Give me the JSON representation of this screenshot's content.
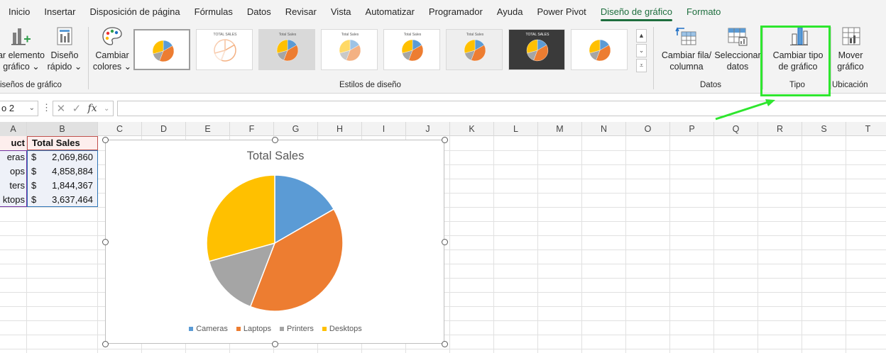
{
  "ribbon_tabs": [
    {
      "label": "Inicio"
    },
    {
      "label": "Insertar"
    },
    {
      "label": "Disposición de página"
    },
    {
      "label": "Fórmulas"
    },
    {
      "label": "Datos"
    },
    {
      "label": "Revisar"
    },
    {
      "label": "Vista"
    },
    {
      "label": "Automatizar"
    },
    {
      "label": "Programador"
    },
    {
      "label": "Ayuda"
    },
    {
      "label": "Power Pivot"
    },
    {
      "label": "Diseño de gráfico"
    },
    {
      "label": "Formato"
    }
  ],
  "active_tab": "Diseño de gráfico",
  "ribbon": {
    "add_element": {
      "line1": "ar elemento",
      "line2": "gráfico ⌄"
    },
    "quick_layout": {
      "line1": "Diseño",
      "line2": "rápido ⌄"
    },
    "group_layouts": "iseños de gráfico",
    "change_colors": {
      "line1": "Cambiar",
      "line2": "colores ⌄"
    },
    "group_styles": "Estilos de diseño",
    "switch_row_col": {
      "line1": "Cambiar fila/",
      "line2": "columna"
    },
    "select_data": {
      "line1": "Seleccionar",
      "line2": "datos"
    },
    "group_data": "Datos",
    "change_type": {
      "line1": "Cambiar tipo",
      "line2": "de gráfico"
    },
    "group_type": "Tipo",
    "move_chart": {
      "line1": "Mover",
      "line2": "gráfico"
    },
    "group_location": "Ubicación",
    "gallery_thumb_titles": [
      "TOTAL SALES",
      "Total Sales",
      "Total Sales",
      "Total Sales",
      "Total Sales",
      "TOTAL SALES"
    ]
  },
  "formula_bar": {
    "name_box": "o 2",
    "fx": "fx",
    "formula": ""
  },
  "columns": [
    "A",
    "B",
    "C",
    "D",
    "E",
    "F",
    "G",
    "H",
    "I",
    "J",
    "K",
    "L",
    "M",
    "N",
    "O",
    "P",
    "Q",
    "R",
    "S",
    "T"
  ],
  "table": {
    "header": [
      "uct",
      "Total Sales"
    ],
    "rows": [
      {
        "product": "eras",
        "currency": "$",
        "value": "2,069,860"
      },
      {
        "product": "ops",
        "currency": "$",
        "value": "4,858,884"
      },
      {
        "product": "ters",
        "currency": "$",
        "value": "1,844,367"
      },
      {
        "product": "ktops",
        "currency": "$",
        "value": "3,637,464"
      }
    ]
  },
  "chart_data": {
    "type": "pie",
    "title": "Total Sales",
    "categories": [
      "Cameras",
      "Laptops",
      "Printers",
      "Desktops"
    ],
    "values": [
      2069860,
      4858884,
      1844367,
      3637464
    ],
    "colors": [
      "#5b9bd5",
      "#ed7d31",
      "#a5a5a5",
      "#ffc000"
    ],
    "legend_position": "bottom"
  }
}
